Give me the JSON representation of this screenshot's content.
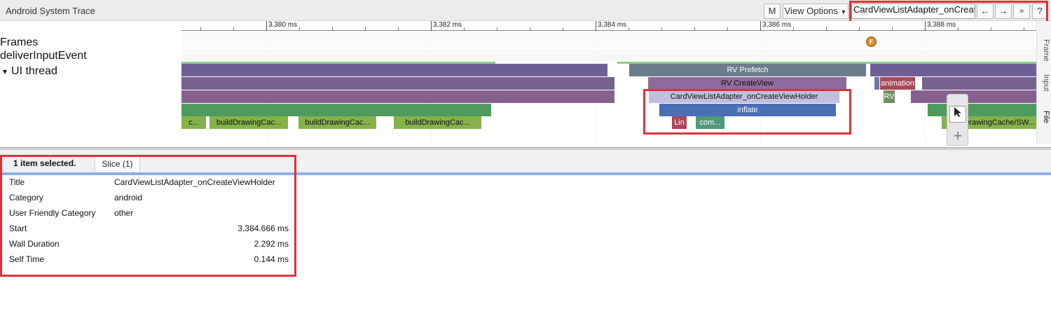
{
  "app": {
    "title": "Android System Trace"
  },
  "toolbar": {
    "m_label": "M",
    "view_options_label": "View Options",
    "search_value": "CardViewListAdapter_onCreat",
    "prev_label": "←",
    "next_label": "→",
    "select_all_label": "»",
    "help_label": "?"
  },
  "tracks": {
    "frames_label": "Frames",
    "deliver_label": "deliverInputEvent",
    "ui_thread_label": "UI thread",
    "expand_icon": "▾"
  },
  "ruler": {
    "ticks": [
      "3,380 ms",
      "3,382 ms",
      "3,384 ms",
      "3,386 ms",
      "3,388 ms"
    ]
  },
  "frame_marker_label": "F",
  "slices": {
    "rv_prefetch": "RV Prefetch",
    "rv_createview": "RV CreateView",
    "animation": "animation",
    "card_view": "CardViewListAdapter_onCreateViewHolder",
    "rv_small": "RV",
    "inflate": "inflate",
    "build_1": "c...",
    "build_2": "buildDrawingCac...",
    "build_3": "buildDrawingCac...",
    "build_4": "buildDrawingCac...",
    "lin": "Lin",
    "com": "com...",
    "build_right": "dDrawingCache/SW..."
  },
  "side_tabs": {
    "frame": "Frame",
    "input": "Input",
    "file": "File"
  },
  "mouse_mode": {
    "select_icon": "arrow-cursor-icon",
    "zoom_icon": "plus-icon"
  },
  "panel": {
    "selection_text": "1 item selected.",
    "tab_label": "Slice (1)",
    "details": [
      {
        "key": "Title",
        "value": "CardViewListAdapter_onCreateViewHolder"
      },
      {
        "key": "Category",
        "value": "android"
      },
      {
        "key": "User Friendly Category",
        "value": "other"
      },
      {
        "key": "Start",
        "value": "3,384.666 ms"
      },
      {
        "key": "Wall Duration",
        "value": "2.292 ms"
      },
      {
        "key": "Self Time",
        "value": "0.144 ms"
      }
    ]
  },
  "colors": {
    "highlight_red": "#e0303a",
    "purple_slice": "#6f5f97",
    "green_slice": "#4f9a5f",
    "olive_slice": "#86b24b",
    "blue_slice": "#4b6fb5"
  }
}
